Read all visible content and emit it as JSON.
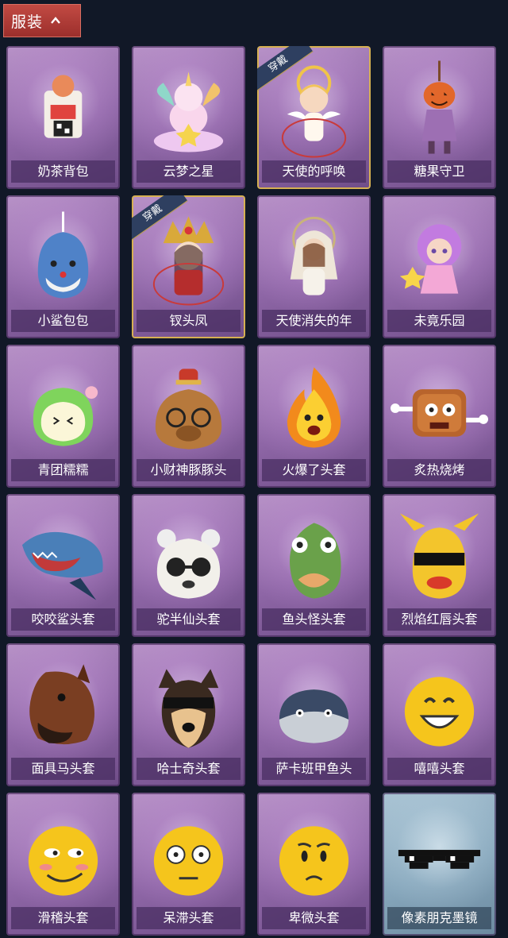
{
  "header": {
    "title": "服装"
  },
  "worn_tag": "穿戴",
  "items": [
    {
      "name": "奶茶背包",
      "icon": "milk-tea-backpack-icon",
      "worn": false,
      "theme": "purple"
    },
    {
      "name": "云梦之星",
      "icon": "unicorn-cloud-icon",
      "worn": false,
      "theme": "purple"
    },
    {
      "name": "天使的呼唤",
      "icon": "angel-doll-icon",
      "worn": true,
      "theme": "purple"
    },
    {
      "name": "糖果守卫",
      "icon": "pumpkin-doll-icon",
      "worn": false,
      "theme": "purple"
    },
    {
      "name": "小鲨包包",
      "icon": "shark-bag-icon",
      "worn": false,
      "theme": "purple"
    },
    {
      "name": "钗头凤",
      "icon": "phoenix-crown-doll-icon",
      "worn": true,
      "theme": "purple"
    },
    {
      "name": "天使消失的年",
      "icon": "veiled-angel-doll-icon",
      "worn": false,
      "theme": "purple"
    },
    {
      "name": "未竟乐园",
      "icon": "pink-hair-doll-icon",
      "worn": false,
      "theme": "purple"
    },
    {
      "name": "青团糯糯",
      "icon": "green-mochi-head-icon",
      "worn": false,
      "theme": "purple"
    },
    {
      "name": "小财神豚豚头",
      "icon": "capybara-god-head-icon",
      "worn": false,
      "theme": "purple"
    },
    {
      "name": "火爆了头套",
      "icon": "fire-head-icon",
      "worn": false,
      "theme": "purple"
    },
    {
      "name": "炙热烧烤",
      "icon": "bbq-meat-head-icon",
      "worn": false,
      "theme": "purple"
    },
    {
      "name": "咬咬鲨头套",
      "icon": "shark-head-icon",
      "worn": false,
      "theme": "purple"
    },
    {
      "name": "驼半仙头套",
      "icon": "bear-sunglasses-head-icon",
      "worn": false,
      "theme": "purple"
    },
    {
      "name": "鱼头怪头套",
      "icon": "fish-head-icon",
      "worn": false,
      "theme": "purple"
    },
    {
      "name": "烈焰红唇头套",
      "icon": "yellow-mask-head-icon",
      "worn": false,
      "theme": "purple"
    },
    {
      "name": "面具马头套",
      "icon": "horse-head-icon",
      "worn": false,
      "theme": "purple"
    },
    {
      "name": "哈士奇头套",
      "icon": "husky-head-icon",
      "worn": false,
      "theme": "purple"
    },
    {
      "name": "萨卡班甲鱼头",
      "icon": "fish-blob-head-icon",
      "worn": false,
      "theme": "purple"
    },
    {
      "name": "嘻嘻头套",
      "icon": "grin-emoji-head-icon",
      "worn": false,
      "theme": "purple"
    },
    {
      "name": "滑稽头套",
      "icon": "smirk-emoji-head-icon",
      "worn": false,
      "theme": "purple"
    },
    {
      "name": "呆滞头套",
      "icon": "stunned-emoji-head-icon",
      "worn": false,
      "theme": "purple"
    },
    {
      "name": "卑微头套",
      "icon": "humble-emoji-head-icon",
      "worn": false,
      "theme": "purple"
    },
    {
      "name": "像素朋克墨镜",
      "icon": "pixel-sunglasses-icon",
      "worn": false,
      "theme": "blue"
    }
  ],
  "colors": {
    "background": "#111827",
    "header_red": "#b03c37",
    "card_purple": "#9a72b2",
    "card_blue": "#8eaec2",
    "worn_border": "#d6b052"
  }
}
